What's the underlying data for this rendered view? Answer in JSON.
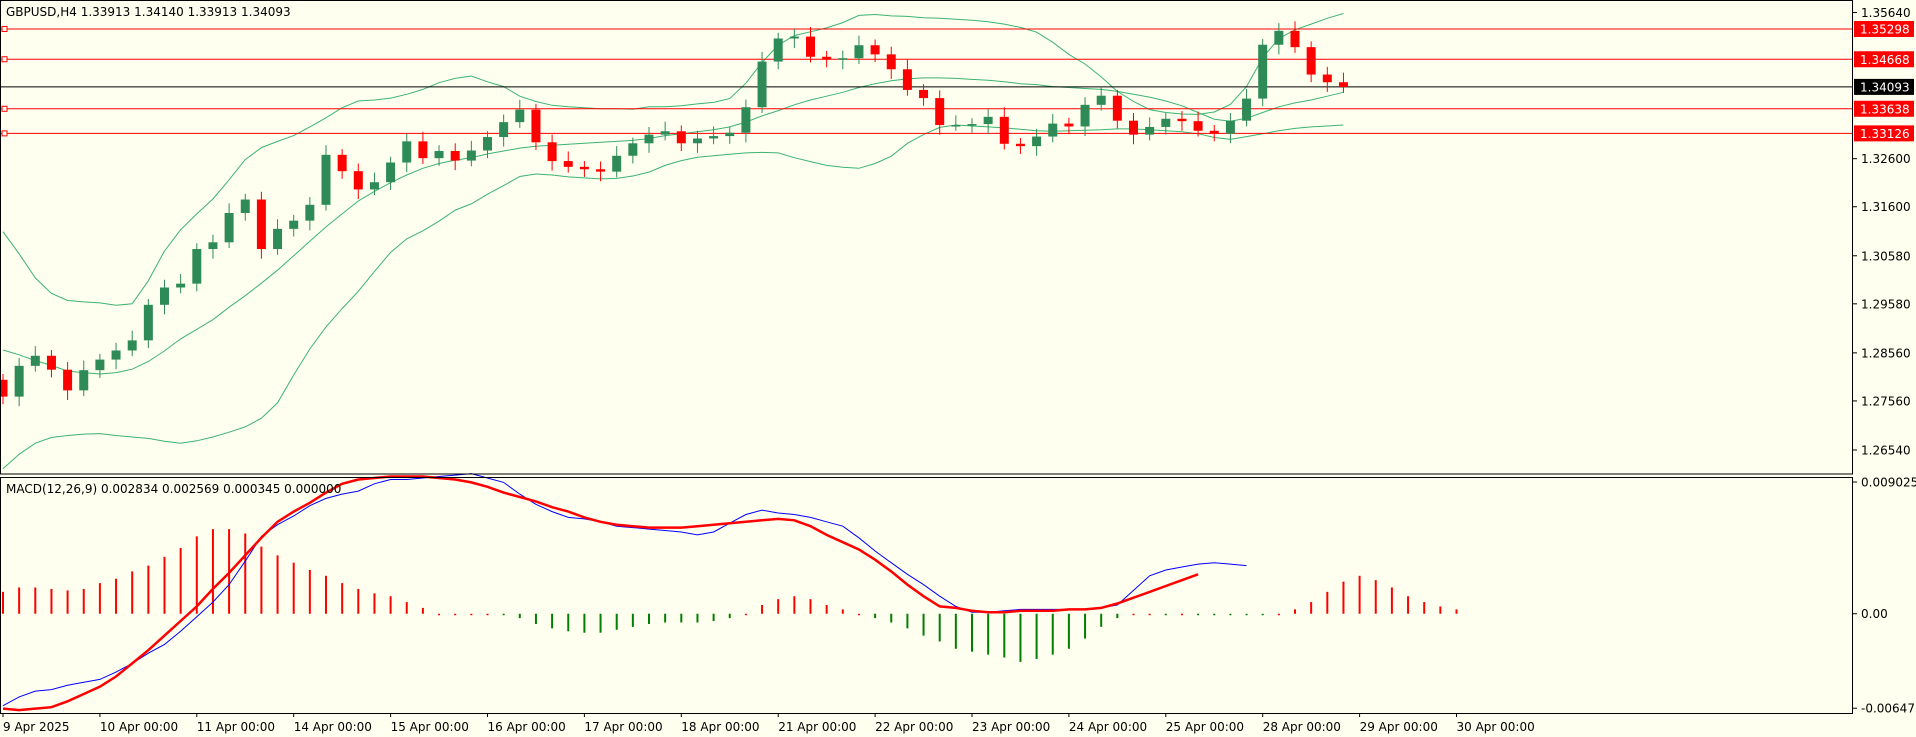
{
  "header": {
    "symbol_line": "GBPUSD,H4  1.33913 1.34140 1.33913 1.34093",
    "macd_line": "MACD(12,26,9) 0.002834 0.002569 0.000345 0.000000"
  },
  "colors": {
    "background": "#fffff0",
    "bull": "#2e8b57",
    "bear": "#ff0000",
    "band": "#3cb371",
    "level_line": "#ff0000",
    "current_line": "#000000",
    "macd_main": "#0000ff",
    "macd_signal": "#ff0000",
    "hist_pos": "#ff0000",
    "hist_neg": "#008000"
  },
  "chart_data": [
    {
      "type": "candlestick",
      "title": "GBPUSD,H4  1.33913 1.34140 1.33913 1.34093",
      "ylim": [
        1.2604,
        1.3588
      ],
      "y_ticks": [
        "1.35640",
        "1.32600",
        "1.31600",
        "1.30580",
        "1.29580",
        "1.28560",
        "1.27560",
        "1.26540"
      ],
      "y_tick_values": [
        1.3564,
        1.326,
        1.316,
        1.3058,
        1.2958,
        1.2856,
        1.2756,
        1.2654
      ],
      "x_ticks": [
        "9 Apr 2025",
        "10 Apr 00:00",
        "11 Apr 00:00",
        "14 Apr 00:00",
        "15 Apr 00:00",
        "16 Apr 00:00",
        "17 Apr 00:00",
        "18 Apr 00:00",
        "21 Apr 00:00",
        "22 Apr 00:00",
        "23 Apr 00:00",
        "24 Apr 00:00",
        "25 Apr 00:00",
        "28 Apr 00:00",
        "29 Apr 00:00",
        "30 Apr 00:00"
      ],
      "x_tick_index": [
        0,
        6,
        12,
        18,
        24,
        30,
        36,
        42,
        48,
        54,
        60,
        66,
        72,
        78,
        84,
        90
      ],
      "price_levels": [
        {
          "label": "1.35298",
          "value": 1.35298
        },
        {
          "label": "1.34668",
          "value": 1.34668
        },
        {
          "label": "1.33638",
          "value": 1.33638
        },
        {
          "label": "1.33126",
          "value": 1.33126
        }
      ],
      "current_price": {
        "label": "1.34093",
        "value": 1.34093
      },
      "closes": [
        1.2765,
        1.2829,
        1.285,
        1.2821,
        1.2778,
        1.282,
        1.2842,
        1.2861,
        1.2882,
        1.2956,
        1.2992,
        1.3,
        1.3072,
        1.3086,
        1.3147,
        1.3175,
        1.3072,
        1.3114,
        1.3131,
        1.3164,
        1.3268,
        1.3234,
        1.3196,
        1.3211,
        1.3252,
        1.3296,
        1.3261,
        1.3276,
        1.3256,
        1.3277,
        1.3305,
        1.3336,
        1.3362,
        1.3294,
        1.3255,
        1.3243,
        1.3238,
        1.3233,
        1.3266,
        1.3292,
        1.331,
        1.3317,
        1.3292,
        1.3302,
        1.3307,
        1.3314,
        1.3367,
        1.3462,
        1.351,
        1.3514,
        1.3472,
        1.3466,
        1.3469,
        1.3496,
        1.3477,
        1.3446,
        1.3403,
        1.3386,
        1.333,
        1.333,
        1.3332,
        1.3347,
        1.3291,
        1.3286,
        1.3306,
        1.3333,
        1.3327,
        1.3372,
        1.3391,
        1.3339,
        1.331,
        1.3326,
        1.3343,
        1.3338,
        1.3318,
        1.3312,
        1.3339,
        1.3385,
        1.3497,
        1.3526,
        1.3492,
        1.3435,
        1.3419,
        1.3409
      ],
      "bb_upper": [
        1.3108,
        1.3062,
        1.3012,
        1.298,
        1.2965,
        1.2962,
        1.296,
        1.2955,
        1.2958,
        1.3006,
        1.3068,
        1.3112,
        1.3145,
        1.3176,
        1.3216,
        1.3258,
        1.3283,
        1.3296,
        1.3308,
        1.3326,
        1.3345,
        1.3366,
        1.338,
        1.3382,
        1.3386,
        1.3394,
        1.3404,
        1.3418,
        1.3427,
        1.3432,
        1.342,
        1.341,
        1.339,
        1.3379,
        1.3371,
        1.3368,
        1.3366,
        1.3364,
        1.3364,
        1.3363,
        1.3368,
        1.3368,
        1.337,
        1.3374,
        1.3377,
        1.3385,
        1.3417,
        1.346,
        1.3496,
        1.3516,
        1.3524,
        1.3532,
        1.3543,
        1.3558,
        1.356,
        1.3557,
        1.3556,
        1.3553,
        1.3552,
        1.355,
        1.3548,
        1.3545,
        1.354,
        1.3533,
        1.3523,
        1.3502,
        1.3477,
        1.3457,
        1.343,
        1.34,
        1.3379,
        1.3362,
        1.3356,
        1.3353,
        1.3352,
        1.3357,
        1.3373,
        1.341,
        1.347,
        1.351,
        1.3528,
        1.354,
        1.3552,
        1.3562
      ],
      "bb_middle": [
        1.2862,
        1.2852,
        1.284,
        1.283,
        1.2818,
        1.2815,
        1.2812,
        1.2815,
        1.2822,
        1.2838,
        1.286,
        1.2885,
        1.2905,
        1.2925,
        1.2951,
        1.2975,
        1.3001,
        1.3028,
        1.3058,
        1.3088,
        1.3118,
        1.3145,
        1.3172,
        1.3192,
        1.321,
        1.3226,
        1.324,
        1.325,
        1.3257,
        1.3262,
        1.327,
        1.3276,
        1.3282,
        1.3286,
        1.3288,
        1.329,
        1.3292,
        1.3294,
        1.3296,
        1.3298,
        1.3302,
        1.3308,
        1.3312,
        1.3316,
        1.332,
        1.3326,
        1.3336,
        1.3349,
        1.336,
        1.3372,
        1.3382,
        1.339,
        1.3398,
        1.3408,
        1.3416,
        1.3422,
        1.3426,
        1.3428,
        1.3428,
        1.3427,
        1.3425,
        1.3423,
        1.342,
        1.3416,
        1.3414,
        1.341,
        1.3408,
        1.3406,
        1.3404,
        1.34,
        1.3394,
        1.3388,
        1.338,
        1.337,
        1.3356,
        1.3342,
        1.3338,
        1.3344,
        1.3356,
        1.3368,
        1.3376,
        1.3382,
        1.339,
        1.3398
      ],
      "bb_lower": [
        1.2615,
        1.2645,
        1.2668,
        1.268,
        1.2684,
        1.2687,
        1.2688,
        1.2684,
        1.2681,
        1.2678,
        1.2672,
        1.2668,
        1.2673,
        1.2681,
        1.2691,
        1.2702,
        1.272,
        1.2752,
        1.281,
        1.2864,
        1.291,
        1.2948,
        1.2984,
        1.3025,
        1.3065,
        1.3093,
        1.311,
        1.313,
        1.3153,
        1.3166,
        1.3186,
        1.3204,
        1.3223,
        1.3228,
        1.3226,
        1.3222,
        1.322,
        1.3218,
        1.3219,
        1.3224,
        1.3232,
        1.3246,
        1.3256,
        1.3263,
        1.3266,
        1.3269,
        1.3272,
        1.3273,
        1.3272,
        1.3262,
        1.3254,
        1.3246,
        1.3242,
        1.324,
        1.325,
        1.3265,
        1.3292,
        1.331,
        1.3325,
        1.333,
        1.3328,
        1.3326,
        1.3324,
        1.3321,
        1.3318,
        1.3317,
        1.3318,
        1.3319,
        1.332,
        1.3322,
        1.3322,
        1.332,
        1.3318,
        1.3316,
        1.3312,
        1.3304,
        1.33,
        1.3306,
        1.3312,
        1.3318,
        1.3323,
        1.3326,
        1.3328,
        1.333
      ]
    },
    {
      "type": "macd",
      "title": "MACD(12,26,9) 0.002834 0.002569 0.000345 0.000000",
      "ylim": [
        -0.0068,
        0.0093
      ],
      "y_ticks": [
        "0.009025",
        "0.00",
        "-0.006473"
      ],
      "y_tick_values": [
        0.009025,
        0.0,
        -0.006473
      ],
      "histogram": [
        0.0015,
        0.0018,
        0.0018,
        0.0017,
        0.0016,
        0.0017,
        0.0021,
        0.0024,
        0.0029,
        0.0033,
        0.0039,
        0.0045,
        0.0053,
        0.0058,
        0.0058,
        0.0055,
        0.0046,
        0.004,
        0.0035,
        0.003,
        0.0026,
        0.0021,
        0.0017,
        0.0014,
        0.0012,
        0.0008,
        0.0004,
        0.0001,
        0.0001,
        0.0001,
        0.0,
        -0.0001,
        -0.0003,
        -0.0007,
        -0.001,
        -0.0012,
        -0.0013,
        -0.0013,
        -0.0011,
        -0.0009,
        -0.0007,
        -0.0006,
        -0.0006,
        -0.0006,
        -0.0005,
        -0.0003,
        0.0,
        0.0006,
        0.001,
        0.0012,
        0.001,
        0.0006,
        0.0003,
        0.0001,
        -0.0003,
        -0.0006,
        -0.001,
        -0.0015,
        -0.0019,
        -0.0024,
        -0.0026,
        -0.0028,
        -0.003,
        -0.0033,
        -0.0031,
        -0.0028,
        -0.0024,
        -0.0017,
        -0.0009,
        -0.0003,
        0.0,
        0.0,
        -0.0001,
        0.0,
        -0.0001,
        -0.0001,
        -0.0001,
        -0.0001,
        -0.0001,
        0.0,
        0.0003,
        0.0008,
        0.0015,
        0.0022,
        0.0026,
        0.0023,
        0.0018,
        0.0012,
        0.0008,
        0.0005,
        0.0003
      ],
      "macd": [
        -0.0063,
        -0.0057,
        -0.0053,
        -0.0052,
        -0.0049,
        -0.0047,
        -0.0045,
        -0.004,
        -0.0034,
        -0.0027,
        -0.0021,
        -0.0012,
        -0.0002,
        0.0008,
        0.002,
        0.0036,
        0.0053,
        0.0061,
        0.0067,
        0.0074,
        0.0079,
        0.0082,
        0.0084,
        0.0089,
        0.0092,
        0.0092,
        0.0093,
        0.0094,
        0.0095,
        0.0096,
        0.0093,
        0.009,
        0.0082,
        0.0075,
        0.007,
        0.0066,
        0.0065,
        0.0063,
        0.006,
        0.0059,
        0.0058,
        0.0057,
        0.0056,
        0.0054,
        0.0056,
        0.0062,
        0.0068,
        0.0071,
        0.0069,
        0.0068,
        0.0066,
        0.0063,
        0.006,
        0.0052,
        0.0043,
        0.0035,
        0.0027,
        0.002,
        0.0012,
        0.0005,
        0.0001,
        0.0001,
        0.0002,
        0.0003,
        0.0003,
        0.0003,
        0.0003,
        0.0003,
        0.0004,
        0.0006,
        0.0016,
        0.0026,
        0.003,
        0.0032,
        0.0034,
        0.0035,
        0.0034,
        0.0033
      ],
      "signal": [
        -0.0065,
        -0.0066,
        -0.0065,
        -0.0064,
        -0.006,
        -0.0055,
        -0.005,
        -0.0043,
        -0.0034,
        -0.0025,
        -0.0015,
        -0.0005,
        0.0005,
        0.0017,
        0.0028,
        0.004,
        0.0052,
        0.0063,
        0.007,
        0.0076,
        0.0083,
        0.0089,
        0.0092,
        0.0093,
        0.0094,
        0.0094,
        0.0094,
        0.0093,
        0.0092,
        0.009,
        0.0087,
        0.0083,
        0.008,
        0.0077,
        0.0073,
        0.007,
        0.0066,
        0.0063,
        0.0061,
        0.006,
        0.0059,
        0.0059,
        0.0059,
        0.006,
        0.0061,
        0.0062,
        0.0063,
        0.0064,
        0.0065,
        0.0064,
        0.006,
        0.0054,
        0.0049,
        0.0044,
        0.0037,
        0.0029,
        0.002,
        0.0012,
        0.0005,
        0.0004,
        0.0002,
        0.0001,
        0.0001,
        0.0002,
        0.0002,
        0.0002,
        0.0003,
        0.0003,
        0.0004,
        0.0007,
        0.0011,
        0.0015,
        0.0019,
        0.0023,
        0.0027
      ]
    }
  ]
}
